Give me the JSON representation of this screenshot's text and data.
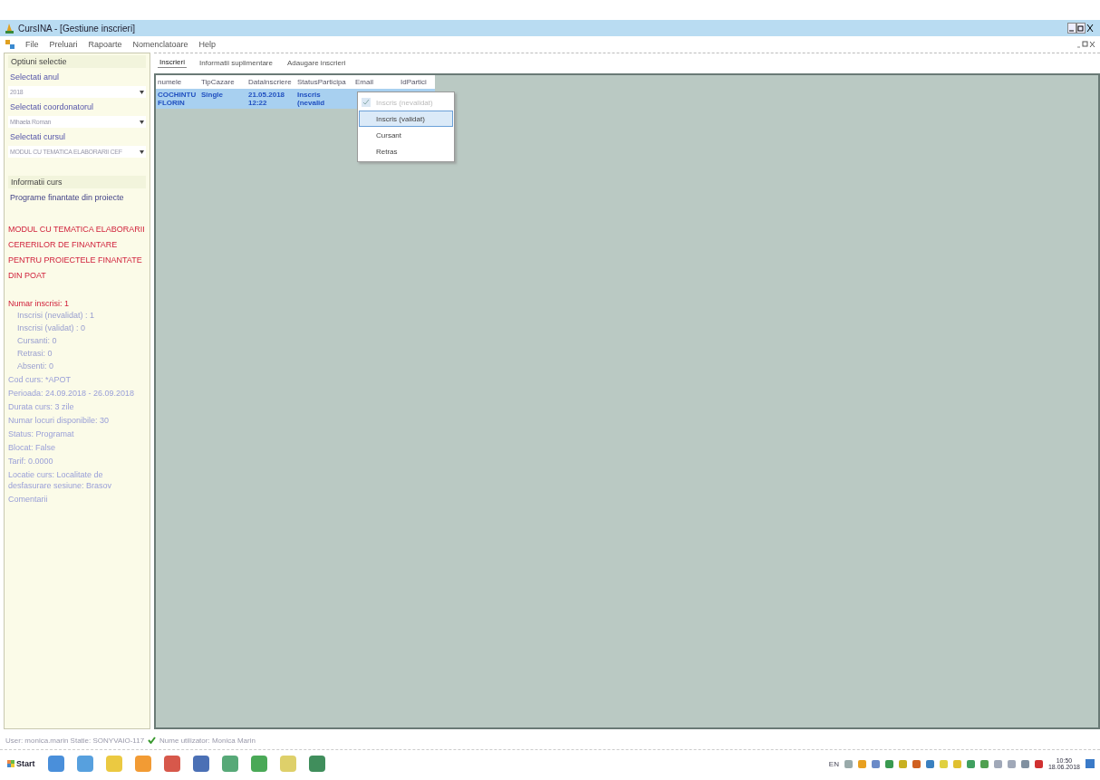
{
  "window": {
    "title": "CursINA - [Gestiune inscrieri]"
  },
  "menu": [
    "File",
    "Preluari",
    "Rapoarte",
    "Nomenclatoare",
    "Help"
  ],
  "sidebar": {
    "section_title": "Optiuni selectie",
    "fields": [
      {
        "label": "Selectati anul",
        "value": "2018"
      },
      {
        "label": "Selectati coordonatorul",
        "value": "Mihaela Roman"
      },
      {
        "label": "Selectati cursul",
        "value": "MODUL CU TEMATICA ELABORARII CEF"
      }
    ],
    "info_title": "Informatii curs",
    "program": "Programe finantate din proiecte",
    "course_name": "MODUL CU TEMATICA ELABORARII CERERILOR DE FINANTARE PENTRU PROIECTELE FINANTATE DIN POAT",
    "total": "Numar inscrisi: 1",
    "counts": [
      "Inscrisi (nevalidat) : 1",
      "Inscrisi (validat) : 0",
      "Cursanti: 0",
      "Retrasi: 0",
      "Absenti: 0"
    ],
    "details": [
      "Cod curs: *APOT",
      "Perioada: 24.09.2018 - 26.09.2018",
      "Durata curs: 3 zile",
      "Numar locuri disponibile: 30",
      "Status: Programat",
      "Blocat: False",
      "Tarif: 0.0000",
      "Locatie curs: Localitate de desfasurare sesiune: Brasov",
      "Comentarii"
    ]
  },
  "tabs": [
    {
      "label": "Inscrieri",
      "selected": true
    },
    {
      "label": "Informatii suplimentare",
      "selected": false
    },
    {
      "label": "Adaugare inscrieri",
      "selected": false
    }
  ],
  "table": {
    "columns": [
      "numele",
      "TipCazare",
      "DataInscriere",
      "StatusParticipa",
      "Email",
      "IdPartici"
    ],
    "rows": [
      {
        "selected": true,
        "cells": [
          "COCHINTU FLORIN",
          "Single",
          "21.05.2018 12:22",
          "Inscris (nevalid",
          "",
          ""
        ]
      }
    ]
  },
  "context_menu": [
    {
      "label": "Inscris (nevalidat)",
      "checked": true,
      "disabled": true,
      "selected": false
    },
    {
      "label": "Inscris (validat)",
      "checked": false,
      "disabled": false,
      "selected": true
    },
    {
      "label": "Cursant",
      "checked": false,
      "disabled": false,
      "selected": false
    },
    {
      "label": "Retras",
      "checked": false,
      "disabled": false,
      "selected": false
    }
  ],
  "status_bar": {
    "user": "User: monica.marin  Statie: SONYVAIO-117",
    "name": "Nume utilizator: Monica Marin"
  },
  "taskbar": {
    "start": "Start",
    "language": "EN",
    "time": "10:50",
    "date": "18.06.2018"
  }
}
